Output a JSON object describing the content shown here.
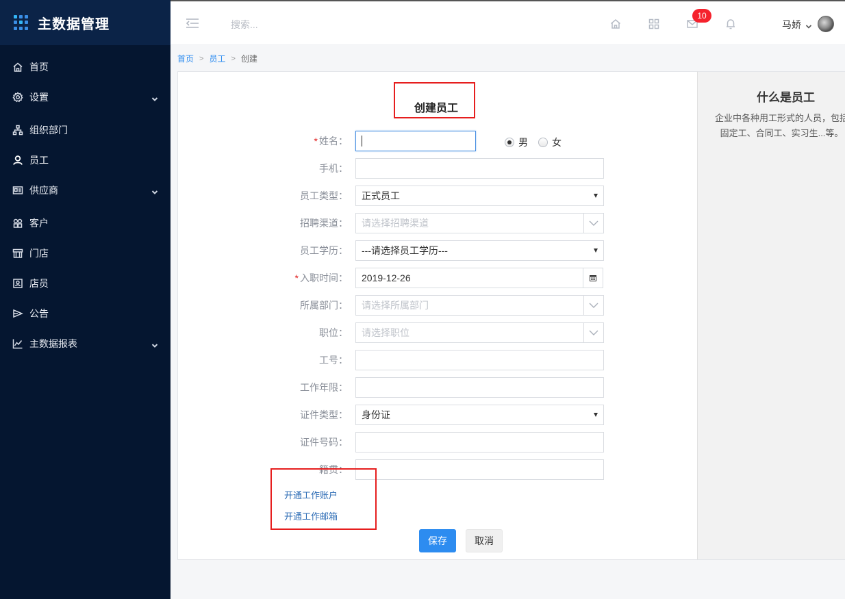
{
  "brand": {
    "title": "主数据管理"
  },
  "sidebar": {
    "items": [
      {
        "label": "首页",
        "icon": "home-icon"
      },
      {
        "label": "设置",
        "icon": "gear-icon",
        "expandable": true
      },
      {
        "label": "组织部门",
        "icon": "org-chart-icon"
      },
      {
        "label": "员工",
        "icon": "user-icon",
        "active": true
      },
      {
        "label": "供应商",
        "icon": "id-card-icon",
        "expandable": true
      },
      {
        "label": "客户",
        "icon": "customer-icon"
      },
      {
        "label": "门店",
        "icon": "store-icon"
      },
      {
        "label": "店员",
        "icon": "clerk-icon"
      },
      {
        "label": "公告",
        "icon": "announcement-icon"
      },
      {
        "label": "主数据报表",
        "icon": "line-chart-icon",
        "expandable": true
      }
    ]
  },
  "header": {
    "search_placeholder": "搜索...",
    "mail_badge": "10",
    "user_name": "马娇"
  },
  "breadcrumb": {
    "home": "首页",
    "section": "员工",
    "current": "创建"
  },
  "form": {
    "title": "创建员工",
    "name_label": "姓名：",
    "gender_male": "男",
    "gender_female": "女",
    "phone_label": "手机：",
    "type_label": "员工类型：",
    "type_value": "正式员工",
    "channel_label": "招聘渠道：",
    "channel_placeholder": "请选择招聘渠道",
    "education_label": "员工学历：",
    "education_value": "---请选择员工学历---",
    "hire_date_label": "入职时间：",
    "hire_date_value": "2019-12-26",
    "dept_label": "所属部门：",
    "dept_placeholder": "请选择所属部门",
    "position_label": "职位：",
    "position_placeholder": "请选择职位",
    "job_no_label": "工号：",
    "years_label": "工作年限：",
    "id_type_label": "证件类型：",
    "id_type_value": "身份证",
    "id_no_label": "证件号码：",
    "native_label": "籍贯：",
    "link_account": "开通工作账户",
    "link_email": "开通工作邮箱",
    "save_label": "保存",
    "cancel_label": "取消"
  },
  "help": {
    "title": "什么是员工",
    "text": "企业中各种用工形式的人员，包括固定工、合同工、实习生...等。"
  },
  "colors": {
    "sidebar_bg": "#051630",
    "brand_bg": "#0b2347",
    "primary": "#2d8cf0",
    "highlight": "#e61e1e",
    "badge": "#f5222d"
  }
}
